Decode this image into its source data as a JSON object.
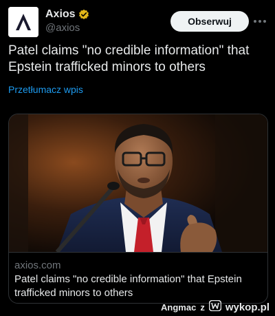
{
  "post": {
    "author_name": "Axios",
    "author_handle": "@axios",
    "follow_label": "Obserwuj",
    "text": "Patel claims \"no credible information\" that Epstein trafficked minors to others",
    "translate_label": "Przetłumacz wpis"
  },
  "link_card": {
    "domain": "axios.com",
    "title": "Patel claims \"no credible information\" that Epstein trafficked minors to others"
  },
  "watermark": {
    "username": "Angmac",
    "separator": "z",
    "site": "wykop.pl"
  },
  "colors": {
    "background": "#000000",
    "text_primary": "#e7e9ea",
    "text_secondary": "#71767b",
    "link_blue": "#1d9bf0",
    "verified_gold": "#e2b719",
    "follow_button_bg": "#eff3f4",
    "axios_logo": "#1a1a2e"
  },
  "icons": {
    "avatar": "axios-logo-icon",
    "verified": "verified-badge-icon",
    "more": "more-options-icon",
    "watermark_logo": "wykop-logo-icon"
  }
}
